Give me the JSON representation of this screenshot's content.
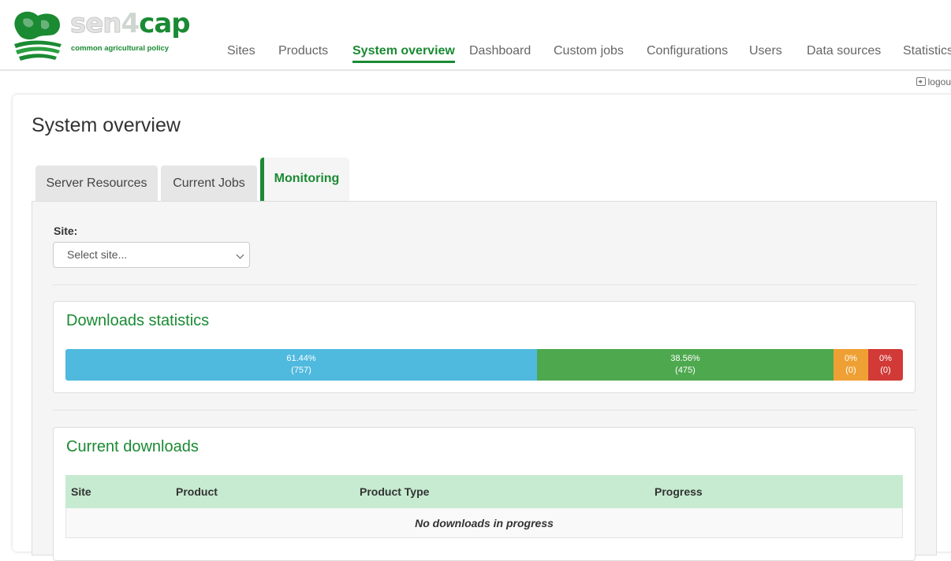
{
  "brand": {
    "name_sen": "sen",
    "name_four": "4",
    "name_cap": "cap",
    "tagline": "common agricultural policy",
    "accent_color": "#1a8a33"
  },
  "nav": {
    "items": [
      {
        "label": "Sites"
      },
      {
        "label": "Products"
      },
      {
        "label": "System overview",
        "active": true
      },
      {
        "label": "Dashboard"
      },
      {
        "label": "Custom jobs"
      },
      {
        "label": "Configurations"
      },
      {
        "label": "Users"
      },
      {
        "label": "Data sources"
      },
      {
        "label": "Statistics"
      }
    ]
  },
  "logout": {
    "label": "logou",
    "icon": "logout-icon"
  },
  "page": {
    "title": "System overview"
  },
  "tabs": [
    {
      "label": "Server Resources"
    },
    {
      "label": "Current Jobs"
    },
    {
      "label": "Monitoring",
      "active": true
    }
  ],
  "monitoring": {
    "site_label": "Site:",
    "site_select": {
      "value": "Select site...",
      "icon": "chevron-down-icon"
    },
    "downloads_statistics": {
      "title": "Downloads statistics",
      "segments": [
        {
          "percent": 61.44,
          "percent_label": "61.44%",
          "count_label": "(757)",
          "color": "#4fb9de"
        },
        {
          "percent": 38.56,
          "percent_label": "38.56%",
          "count_label": "(475)",
          "color": "#4ea84e"
        },
        {
          "percent": 0,
          "percent_label": "0%",
          "count_label": "(0)",
          "color": "#efa034"
        },
        {
          "percent": 0,
          "percent_label": "0%",
          "count_label": "(0)",
          "color": "#d13a37"
        }
      ]
    },
    "current_downloads": {
      "title": "Current downloads",
      "columns": [
        "Site",
        "Product",
        "Product Type",
        "Progress"
      ],
      "empty_message": "No downloads in progress",
      "header_color": "#c6ebd0"
    }
  }
}
